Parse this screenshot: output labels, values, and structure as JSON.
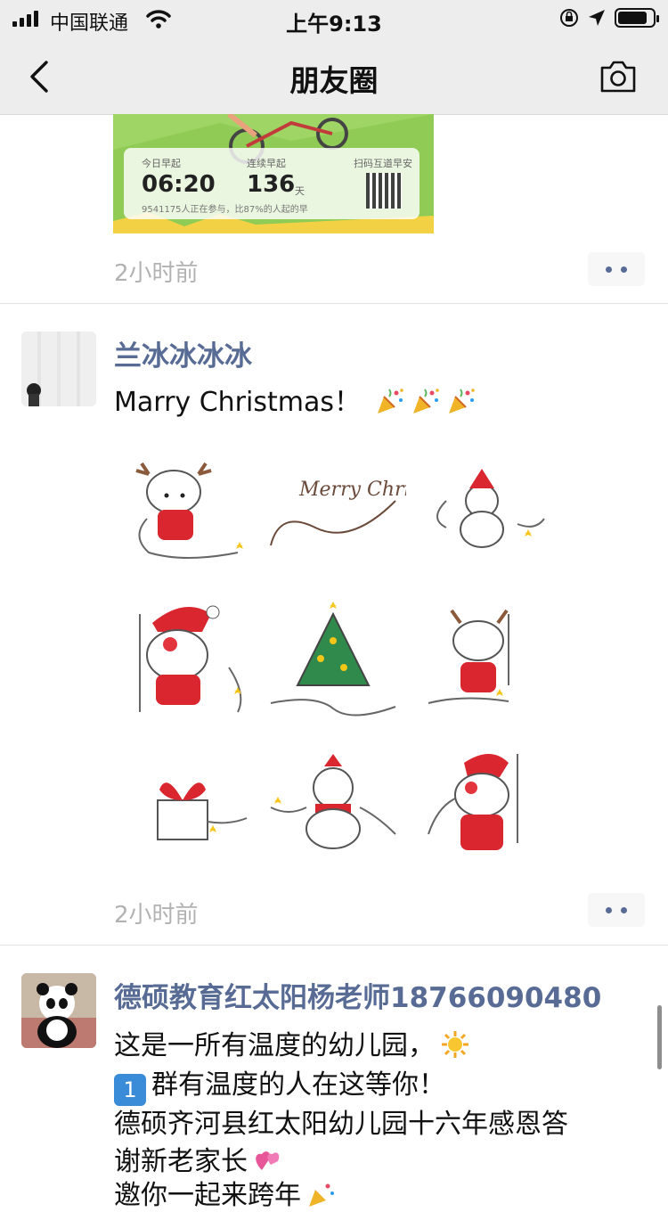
{
  "status_bar": {
    "carrier": "中国联通",
    "time": "上午9:13",
    "battery_level": 0.85
  },
  "nav": {
    "title": "朋友圈"
  },
  "post1": {
    "card": {
      "label_today": "今日早起",
      "today_value": "06:20",
      "label_streak": "连续早起",
      "streak_value": "136",
      "streak_unit": "天",
      "label_scan": "扫码互道早安",
      "footer": "9541175人正在参与，比87%的人起的早"
    },
    "time": "2小时前"
  },
  "post2": {
    "username": "兰冰冰冰冰",
    "text": "Marry Christmas！",
    "emojis": [
      "party-popper-icon",
      "party-popper-icon",
      "party-popper-icon"
    ],
    "image_text": "Merry Christmas",
    "time": "2小时前"
  },
  "post3": {
    "username": "德硕教育红太阳杨老师18766090480",
    "lines": [
      "这是一所有温度的幼儿园，",
      "群有温度的人在这等你！",
      "德硕齐河县红太阳幼儿园十六年感恩答",
      "谢新老家长",
      "邀你一起来跨年"
    ],
    "badge": "1"
  },
  "colors": {
    "link": "#576b95",
    "bar": "#ededed",
    "time": "#b2b2b2"
  }
}
